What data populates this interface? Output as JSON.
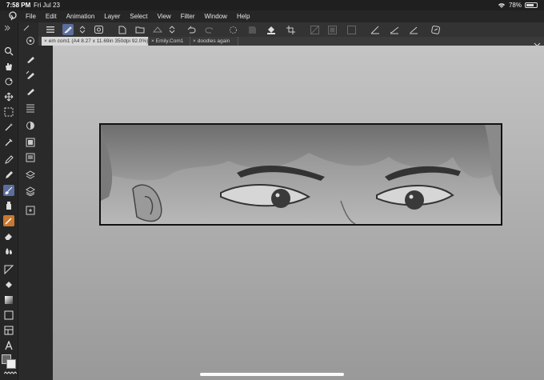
{
  "status": {
    "time": "7:58 PM",
    "date": "Fri Jul 23",
    "battery": "78%",
    "battery_level": 0.78
  },
  "menu": [
    "File",
    "Edit",
    "Animation",
    "Layer",
    "Select",
    "View",
    "Filter",
    "Window",
    "Help"
  ],
  "tabs": [
    {
      "label": "em com1 (A4 8.27 x 11.69in 350dpi 92.0%)",
      "close": "×"
    },
    {
      "label": "Emily.Com1",
      "close": "×"
    },
    {
      "label": "doodles again",
      "close": "×"
    }
  ],
  "toolbar_icons": [
    "menu-icon",
    "pen-pressure-icon",
    "chevron-updown-icon",
    "stabilizer-icon",
    "new-file-icon",
    "open-folder-icon",
    "save-icon",
    "chevron-updown-icon",
    "undo-icon",
    "redo-icon",
    "loading-spinner-icon",
    "transform-icon",
    "fill-icon",
    "crop-icon",
    "clear-icon",
    "layer-opacity-icon",
    "cancel-select-icon",
    "ruler-icon",
    "brush-icon",
    "eraser-pencil-icon",
    "help-icon"
  ],
  "tool_icons": [
    "zoom-icon",
    "hand-icon",
    "rotate-icon",
    "move-icon",
    "selection-icon",
    "magic-wand-icon",
    "eyedropper-icon",
    "pen-icon",
    "pencil-icon",
    "brush-icon",
    "airbrush-icon",
    "decoration-icon",
    "eraser-icon",
    "blend-icon",
    "figure-icon",
    "fill-icon",
    "gradient-icon",
    "frame-icon",
    "text-icon",
    "operation-icon"
  ],
  "sub_icons": [
    "subtool-pen-icon",
    "subtool-marker-icon",
    "subtool-gpen-icon",
    "subtool-brush-icon",
    "subtool-texture-icon",
    "subtool-layer-icon",
    "subtool-material-icon",
    "subtool-3d-icon",
    "subtool-stack-icon",
    "subtool-export-icon"
  ],
  "colors": {
    "accent": "#5b6e9c",
    "canvas_top": "#c4c4c4",
    "canvas_bottom": "#999999"
  }
}
